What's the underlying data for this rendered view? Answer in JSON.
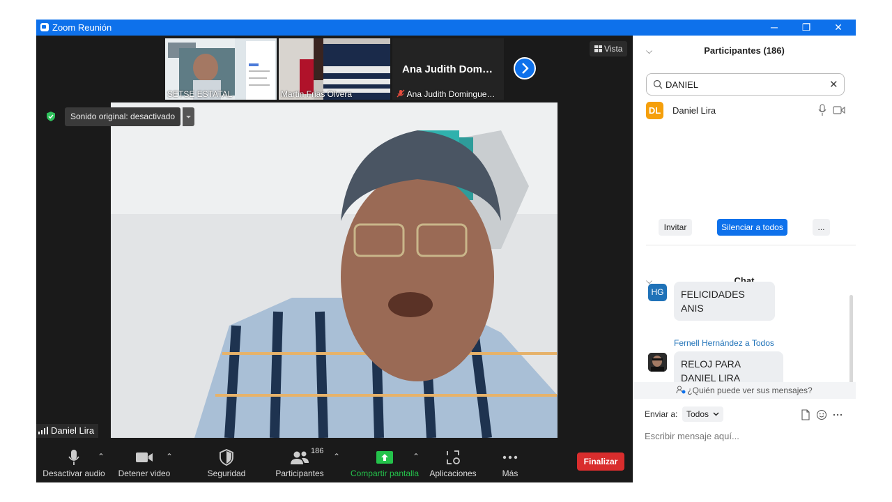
{
  "window": {
    "title": "Zoom Reunión",
    "controls": {
      "minimize": "─",
      "restore": "❐",
      "close": "✕"
    },
    "accent": "#0e71eb"
  },
  "stage": {
    "thumbnails": [
      {
        "name": "SETSE ESTATAL"
      },
      {
        "name": "Martin Frias Olvera"
      },
      {
        "display_name": "Ana Judith Dom…",
        "name": "Ana Judith Domingue…",
        "muted_icon": "muted-mic-icon"
      }
    ],
    "view_button": "Vista",
    "original_sound": "Sonido original: desactivado",
    "active_speaker": "Daniel Lira"
  },
  "toolbar": {
    "audio": "Desactivar audio",
    "video": "Detener video",
    "security": "Seguridad",
    "participants": "Participantes",
    "participants_count": "186",
    "share": "Compartir pantalla",
    "apps": "Aplicaciones",
    "more": "Más",
    "end": "Finalizar",
    "share_color": "#24c24b",
    "end_color": "#d92d2d"
  },
  "participants_panel": {
    "title": "Participantes (186)",
    "search_value": "DANIEL",
    "participant": {
      "initials": "DL",
      "name": "Daniel Lira",
      "avatar_color": "#f59f0b"
    },
    "invite": "Invitar",
    "mute_all": "Silenciar a todos",
    "more": "..."
  },
  "chat_panel": {
    "title": "Chat",
    "messages": [
      {
        "initials": "HG",
        "text": "FELICIDADES ANIS",
        "avatar_color": "#1f72b8"
      },
      {
        "sender": "Fernell Hernández a Todos",
        "text": "RELOJ PARA DANIEL LIRA"
      }
    ],
    "who_can_see": "¿Quién puede ver sus mensajes?",
    "send_to_label": "Enviar a:",
    "send_to_value": "Todos",
    "input_placeholder": "Escribir mensaje aquí..."
  }
}
